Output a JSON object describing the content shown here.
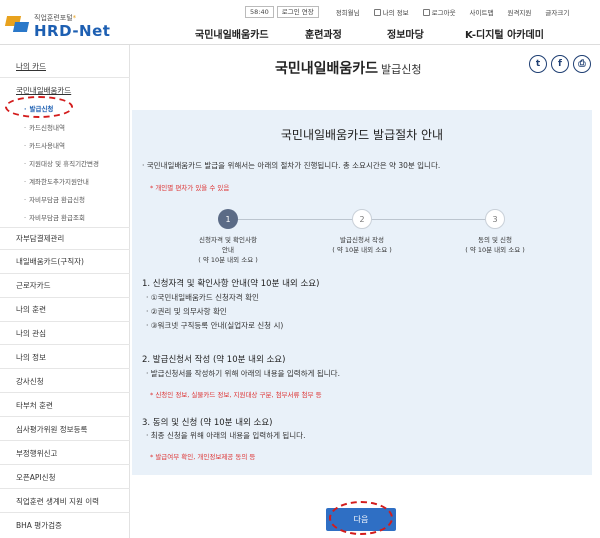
{
  "header": {
    "logo_sub": "직업훈련포털",
    "logo_main": "HRD-Net",
    "timer": "58:40",
    "extend_login": "로그인 연장",
    "util_links": [
      "정희월님",
      "나의 정보",
      "로그아웃",
      "사이트맵",
      "원격지원",
      "글자크기"
    ],
    "gnb": [
      "국민내일배움카드",
      "훈련과정",
      "정보마당",
      "K-디지털 아카데미"
    ]
  },
  "sidebar": {
    "top": "나의 카드",
    "card_section": "국민내일배움카드",
    "subs": [
      "발급신청",
      "카드신청내역",
      "카드사용내역",
      "지원대상 및 휴직기간변경",
      "계좌한도추가지원안내",
      "자비부담금 환급신청",
      "자비부담금 환급조회"
    ],
    "items_a": [
      "자부담결제관리",
      "내일배움카드(구직자)",
      "근로자카드"
    ],
    "items_b": [
      "나의 훈련",
      "나의 관심",
      "나의 정보",
      "강사신청",
      "타부처 훈련",
      "심사평가위원 정보등록",
      "부정행위신고",
      "오픈API신청",
      "직업훈련 생계비 지원 이력",
      "BHA 평가검증"
    ]
  },
  "page": {
    "title": "국민내일배움카드",
    "subtitle": "발급신청",
    "social": [
      "twitter-icon",
      "facebook-icon",
      "print-icon"
    ]
  },
  "panel": {
    "title": "국민내일배움카드 발급절차 안내",
    "intro": "국민내일배움카드 발급을 위해서는 아래의 절차가 진행됩니다. 총 소요시간은 약 30분 입니다.",
    "warn": "* 개인별 편차가 있을 수 있음",
    "steps": [
      {
        "num": "1",
        "line1": "신청자격 및 확인사항",
        "line2": "안내",
        "line3": "( 약 10분 내외 소요 )"
      },
      {
        "num": "2",
        "line1": "발급신청서 작성",
        "line2": "( 약 10분 내외 소요 )",
        "line3": ""
      },
      {
        "num": "3",
        "line1": "동의 및 신청",
        "line2": "( 약 10분 내외 소요 )",
        "line3": ""
      }
    ],
    "sec1_h": "1. 신청자격 및 확인사항 안내(약 10분 내외 소요)",
    "sec1_items": [
      "①국민내일배움카드 신청자격 확인",
      "②권리 및 의무사항 확인",
      "③워크넷 구직등록 안내(실업자로 신청 시)"
    ],
    "sec2_h": "2. 발급신청서 작성 (약 10분 내외 소요)",
    "sec2_item": "발급신청서를 작성하기 위해 아래의 내용을 입력하게 됩니다.",
    "sec2_red": "* 신청인 정보, 실물카드 정보, 지원대상 구분, 첨부서류 첨부 등",
    "sec3_h": "3. 동의 및 신청 (약 10분 내외 소요)",
    "sec3_item": "최종 신청을 위해 아래의 내용을 입력하게 됩니다.",
    "sec3_red": "* 발급여부 확인, 개인정보제공 동의 등"
  },
  "next_button": "다음",
  "colors": {
    "accent": "#2f6fc4",
    "panel_bg": "#e9f1f9",
    "highlight": "#d31c1c"
  }
}
